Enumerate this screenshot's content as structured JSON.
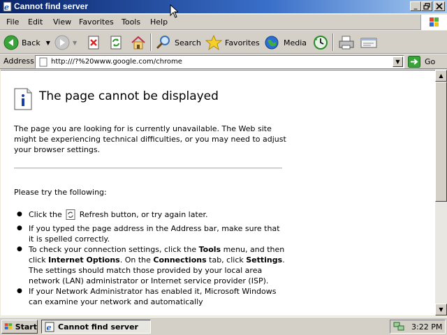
{
  "window": {
    "title": "Cannot find server",
    "title_icon": "ie-page-icon"
  },
  "menu": {
    "items": [
      "File",
      "Edit",
      "View",
      "Favorites",
      "Tools",
      "Help"
    ]
  },
  "toolbar": {
    "back_label": "Back",
    "search_label": "Search",
    "favorites_label": "Favorites",
    "media_label": "Media"
  },
  "address": {
    "label": "Address",
    "value": "http:///?%20www.google.com/chrome",
    "go_label": "Go"
  },
  "page": {
    "title": "The page cannot be displayed",
    "intro": "The page you are looking for is currently unavailable. The Web site might be experiencing technical difficulties, or you may need to adjust your browser settings.",
    "try_heading": "Please try the following:",
    "bullet1_pre": "Click the",
    "bullet1_post": "Refresh button, or try again later.",
    "bullet2": "If you typed the page address in the Address bar, make sure that it is spelled correctly.",
    "bullet3_a": "To check your connection settings, click the",
    "bullet3_tools": "Tools",
    "bullet3_b": "menu, and then click",
    "bullet3_io": "Internet Options",
    "bullet3_c": ". On the",
    "bullet3_conn": "Connections",
    "bullet3_d": "tab, click",
    "bullet3_settings": "Settings",
    "bullet3_e": ". The settings should match those provided by your local area network (LAN) administrator or Internet service provider (ISP).",
    "bullet4": "If your Network Administrator has enabled it, Microsoft Windows can examine your network and automatically"
  },
  "taskbar": {
    "start_label": "Start",
    "task_label": "Cannot find server",
    "clock": "3:22 PM"
  },
  "colors": {
    "titlebar_start": "#0a246a",
    "titlebar_end": "#a6caf0",
    "chrome": "#d4d0c8"
  }
}
